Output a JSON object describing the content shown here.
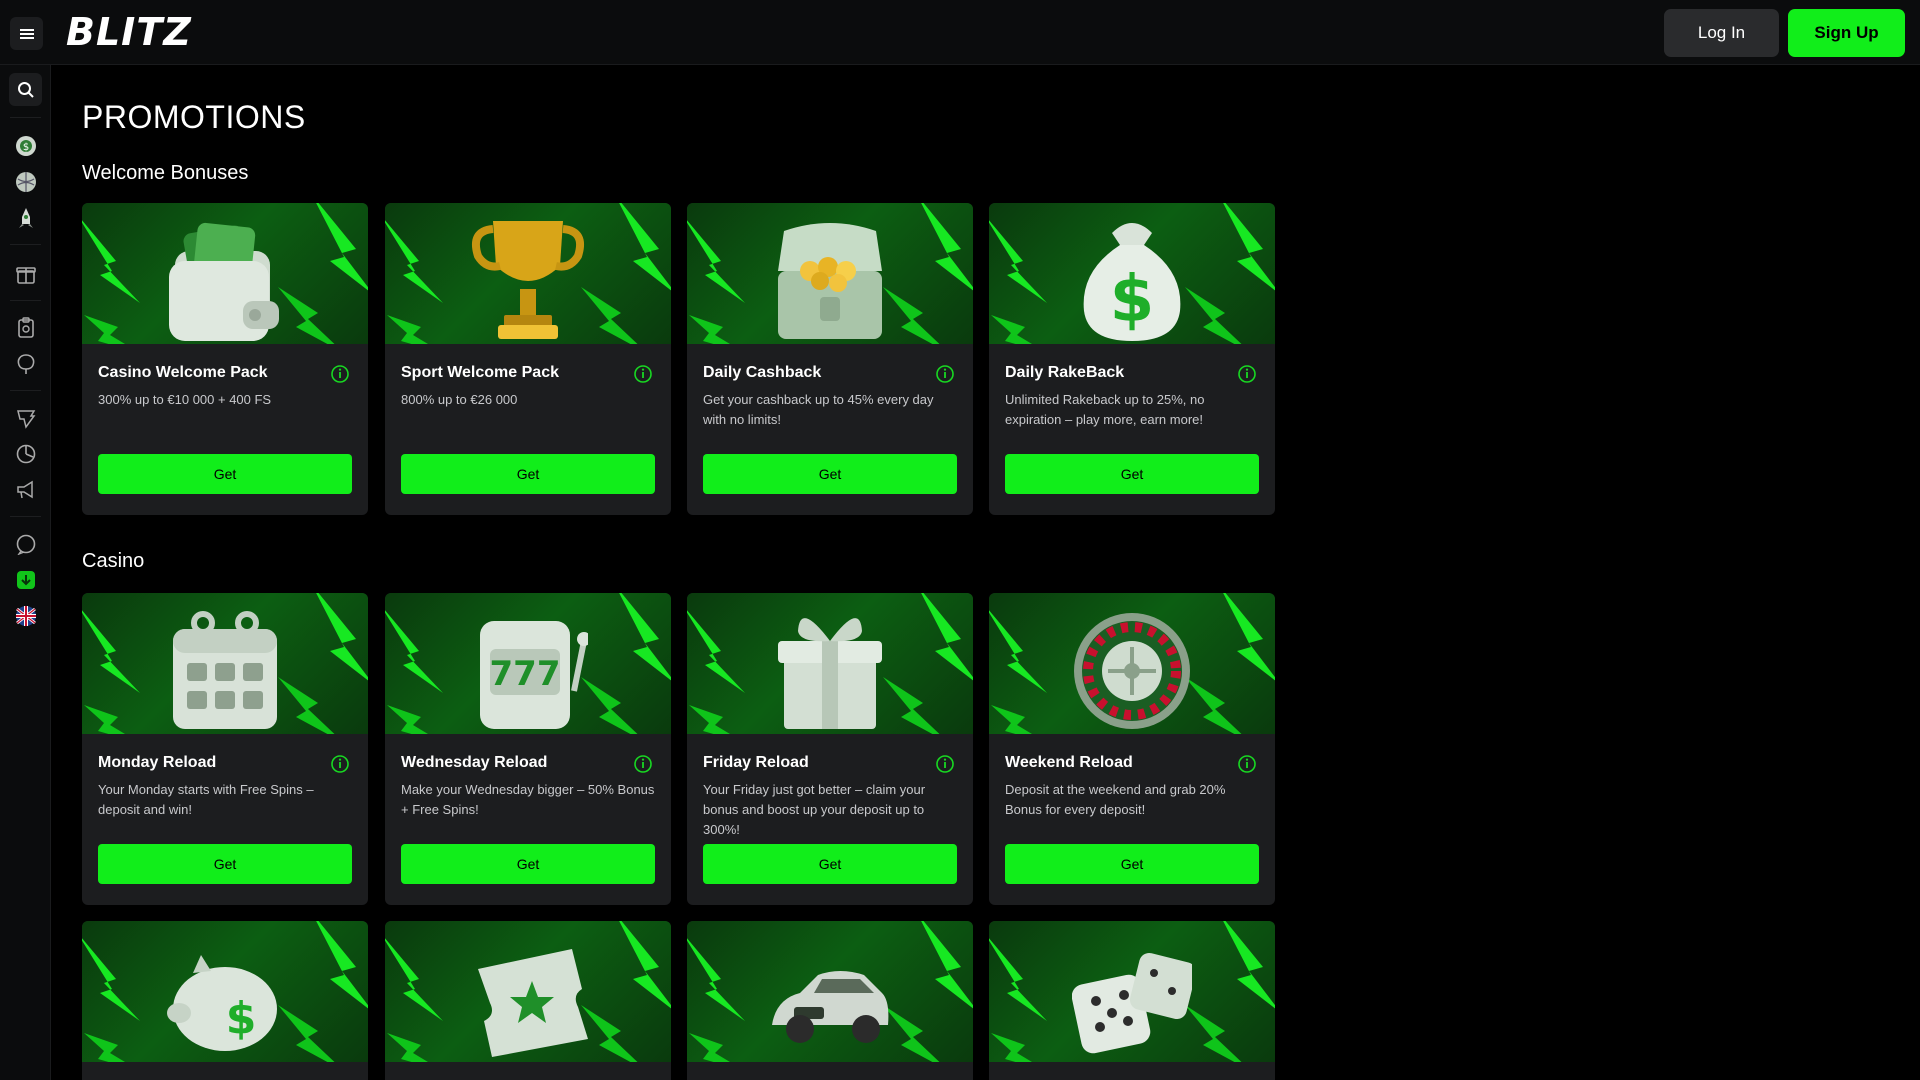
{
  "header": {
    "logo_text": "BLITZ",
    "login_label": "Log In",
    "signup_label": "Sign Up"
  },
  "sidebar": {
    "icons": [
      "menu-icon",
      "search-icon",
      "casino-chip-icon",
      "sports-ball-icon",
      "rocket-icon",
      "gift-icon",
      "tournament-icon",
      "promotions-icon",
      "vip-icon",
      "statistics-icon",
      "megaphone-icon",
      "chat-icon",
      "download-icon",
      "uk-flag-icon"
    ]
  },
  "page": {
    "title": "PROMOTIONS"
  },
  "sections": [
    {
      "title": "Welcome Bonuses",
      "cards": [
        {
          "title": "Casino Welcome Pack",
          "desc": "300% up to €10 000 + 400 FS",
          "button": "Get",
          "art": "wallet"
        },
        {
          "title": "Sport Welcome Pack",
          "desc": "800% up to €26 000",
          "button": "Get",
          "art": "trophy"
        },
        {
          "title": "Daily Cashback",
          "desc": "Get your cashback up to 45% every day with no limits!",
          "button": "Get",
          "art": "chest"
        },
        {
          "title": "Daily RakeBack",
          "desc": "Unlimited Rakeback up to 25%, no expiration – play more, earn more!",
          "button": "Get",
          "art": "moneybag"
        }
      ]
    },
    {
      "title": "Casino",
      "cards": [
        {
          "title": "Monday Reload",
          "desc": "Your Monday starts with Free Spins – deposit and win!",
          "button": "Get",
          "art": "calendar"
        },
        {
          "title": "Wednesday Reload",
          "desc": "Make your Wednesday bigger – 50% Bonus + Free Spins!",
          "button": "Get",
          "art": "slot"
        },
        {
          "title": "Friday Reload",
          "desc": "Your Friday just got better – claim your bonus and boost up your deposit up to 300%!",
          "button": "Get",
          "art": "gift"
        },
        {
          "title": "Weekend Reload",
          "desc": "Deposit at the weekend and grab 20% Bonus for every deposit!",
          "button": "Get",
          "art": "roulette"
        }
      ]
    }
  ],
  "bottom_row": [
    {
      "art": "piggybank"
    },
    {
      "art": "ticket"
    },
    {
      "art": "car"
    },
    {
      "art": "dice"
    }
  ],
  "colors": {
    "accent": "#11ee1a",
    "background": "#000000",
    "card": "#1c1d1f",
    "topbar": "#0b0c0d"
  }
}
